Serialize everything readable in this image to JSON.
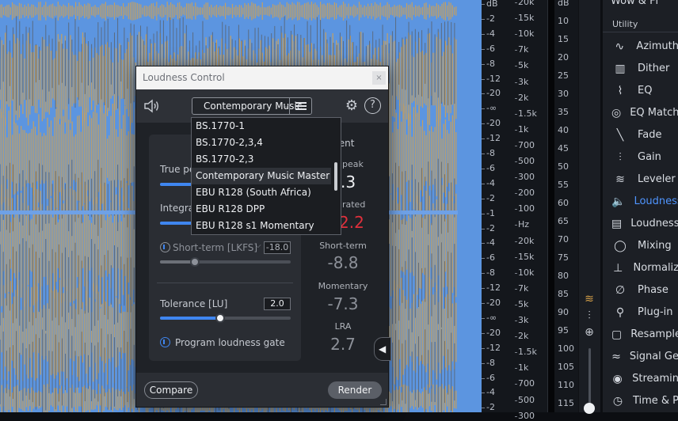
{
  "ruler_db": [
    "dB",
    "-2",
    "-4",
    "-6",
    "-8",
    "-12",
    "-20",
    "-∞",
    "-20",
    "-12",
    "-8",
    "-6",
    "-4",
    "-2",
    "-1",
    "-2",
    "-4",
    "-6",
    "-8",
    "-12",
    "-20",
    "-∞",
    "-20",
    "-12",
    "-8",
    "-6",
    "-4",
    "-2"
  ],
  "ruler_hz": [
    "20k",
    "15k",
    "10k",
    "7k",
    "5k",
    "3k",
    "2k",
    "1.5k",
    "1k",
    "700",
    "500",
    "300",
    "200",
    "100",
    "Hz",
    "20k",
    "15k",
    "10k",
    "7k",
    "5k",
    "3k",
    "2k",
    "1.5k",
    "1k",
    "700",
    "500",
    "300"
  ],
  "meter_db": [
    "dB",
    "10",
    "15",
    "20",
    "25",
    "30",
    "35",
    "40",
    "45",
    "50",
    "55",
    "60",
    "65",
    "70",
    "75",
    "80",
    "85",
    "90",
    "95",
    "100",
    "105",
    "110",
    "115"
  ],
  "modules": {
    "top_item": "Wow & Fl",
    "section": "Utility",
    "items": [
      {
        "label": "Azimuth",
        "icon": "azimuth-icon",
        "glyph": "∿"
      },
      {
        "label": "Dither",
        "icon": "dither-icon",
        "glyph": "▥"
      },
      {
        "label": "EQ",
        "icon": "eq-icon",
        "glyph": "⌇"
      },
      {
        "label": "EQ Match",
        "icon": "eq-match-icon",
        "glyph": "◎"
      },
      {
        "label": "Fade",
        "icon": "fade-icon",
        "glyph": "╲"
      },
      {
        "label": "Gain",
        "icon": "gain-icon",
        "glyph": "⫶"
      },
      {
        "label": "Leveler",
        "icon": "leveler-icon",
        "glyph": "≋"
      },
      {
        "label": "Loudness",
        "icon": "loudness-icon",
        "glyph": "🔈"
      },
      {
        "label": "Loudness",
        "icon": "loudness-optimize-icon",
        "glyph": "▤"
      },
      {
        "label": "Mixing",
        "icon": "mixing-icon",
        "glyph": "◯"
      },
      {
        "label": "Normaliz",
        "icon": "normalize-icon",
        "glyph": "⊥"
      },
      {
        "label": "Phase",
        "icon": "phase-icon",
        "glyph": "∅"
      },
      {
        "label": "Plug-in",
        "icon": "plugin-icon",
        "glyph": "⚲"
      },
      {
        "label": "Resample",
        "icon": "resample-icon",
        "glyph": "▢"
      },
      {
        "label": "Signal Ge",
        "icon": "signal-generator-icon",
        "glyph": "≈"
      },
      {
        "label": "Streamin",
        "icon": "streaming-icon",
        "glyph": "◉"
      },
      {
        "label": "Time & P",
        "icon": "time-pitch-icon",
        "glyph": "◷"
      }
    ],
    "active_index": 7
  },
  "dialog": {
    "title": "Loudness Control",
    "close_label": "×",
    "preset_label": "Contemporary Music",
    "settings": {
      "true_peak_label": "True pe",
      "integrated_label": "Integra",
      "short_term_label": "Short-term [LKFS]",
      "short_term_value": "-18.0",
      "tolerance_label": "Tolerance [LU]",
      "tolerance_value": "2.0",
      "gate_label": "Program loudness gate"
    },
    "measurement": {
      "header": "rement",
      "true_peak_label": "peak",
      "true_peak_value": ".3",
      "integrated_label": "grated",
      "integrated_value": "2.2",
      "short_term_label": "Short-term",
      "short_term_value": "-8.8",
      "momentary_label": "Momentary",
      "momentary_value": "-7.3",
      "lra_label": "LRA",
      "lra_value": "2.7"
    },
    "compare_label": "Compare",
    "render_label": "Render"
  },
  "dropdown": {
    "options": [
      "BS.1770-1",
      "BS.1770-2,3,4",
      "BS.1770-2,3",
      "Contemporary Music Master",
      "EBU R128 (South Africa)",
      "EBU R128 DPP",
      "EBU R128 s1 Momentary"
    ],
    "selected_index": 3
  },
  "colors": {
    "accent": "#3f86f0",
    "integrated_value": "#e0303c",
    "waveform": "#5c95e0",
    "spectrogram": "#d8a24a"
  }
}
